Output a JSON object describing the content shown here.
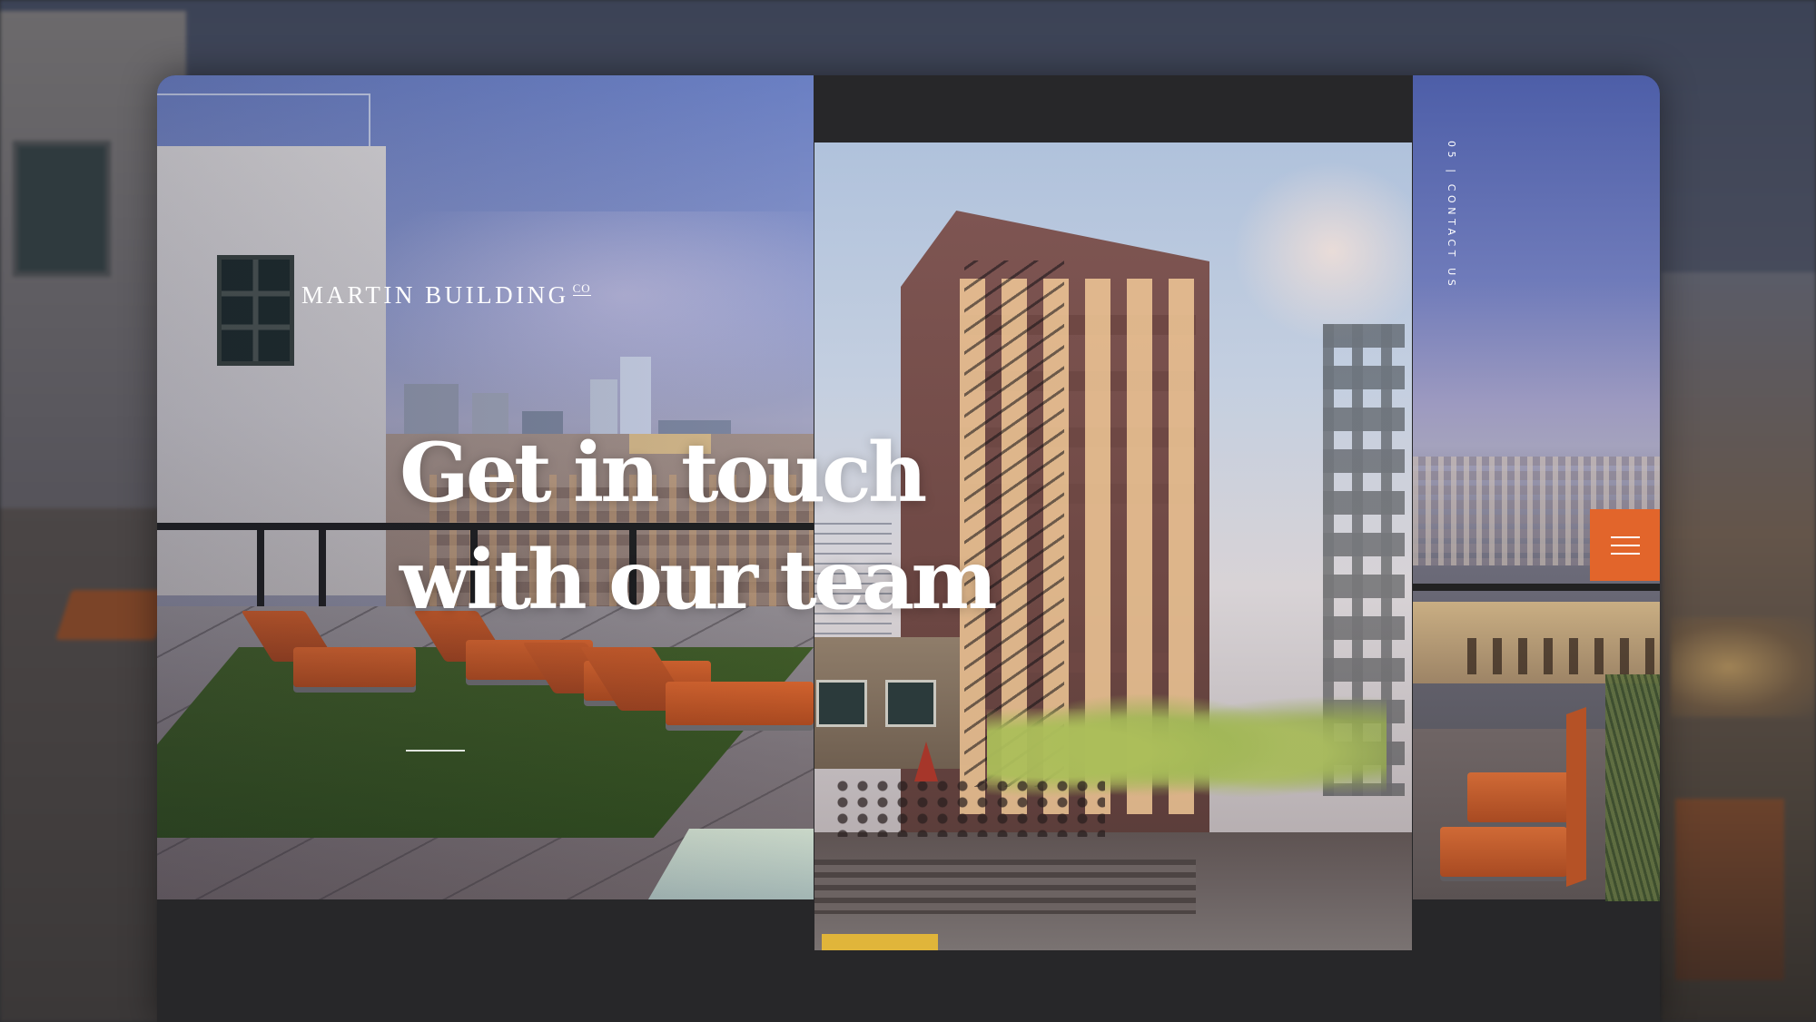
{
  "brand": {
    "name": "MARTIN BUILDING",
    "suffix": "CO"
  },
  "hero": {
    "headline_line1": "Get in touch",
    "headline_line2": "with our team"
  },
  "side_nav": {
    "label": "05 | CONTACT US"
  },
  "menu": {
    "icon": "hamburger-menu-icon",
    "color": "#E2652B"
  },
  "colors": {
    "accent": "#E2652B",
    "text": "#FFFFFF",
    "page_background": "#272729"
  }
}
